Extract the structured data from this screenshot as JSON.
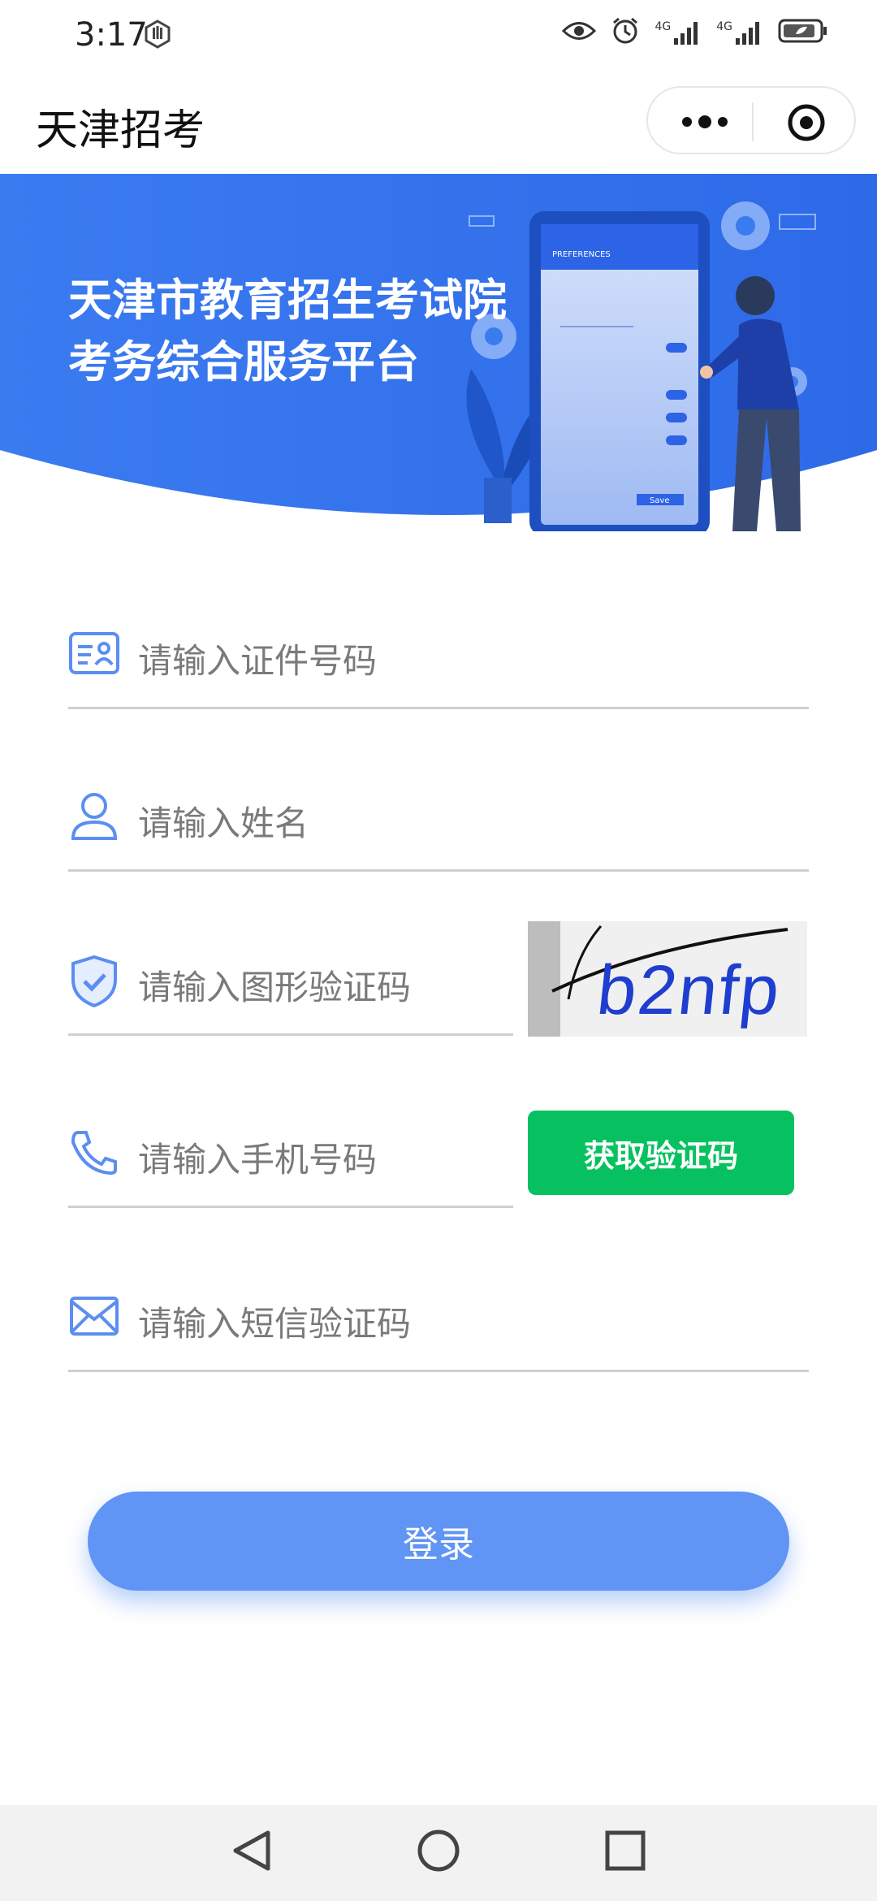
{
  "status_bar": {
    "time": "3:17",
    "icons": [
      "hand-icon",
      "eye-icon",
      "alarm-icon",
      "signal-4g-icon",
      "signal-4g-icon",
      "battery-icon"
    ],
    "network_1": "4G",
    "network_2": "4G"
  },
  "title_bar": {
    "title": "天津招考",
    "more_icon": "more-dots-icon",
    "close_icon": "target-close-icon"
  },
  "banner": {
    "line1": "天津市教育招生考试院",
    "line2": "考务综合服务平台",
    "phone_heading": "PREFERENCES",
    "phone_save": "Save"
  },
  "form": {
    "id_placeholder": "请输入证件号码",
    "name_placeholder": "请输入姓名",
    "captcha_placeholder": "请输入图形验证码",
    "captcha_text": "b2nfp",
    "phone_placeholder": "请输入手机号码",
    "get_code_label": "获取验证码",
    "sms_placeholder": "请输入短信验证码",
    "login_label": "登录"
  },
  "colors": {
    "banner": "#3f7ff2",
    "login": "#6094f5",
    "sms_button": "#07c160",
    "icon_blue": "#5b8ef0"
  },
  "nav_bar": {
    "icons": [
      "back-triangle-icon",
      "home-circle-icon",
      "recent-square-icon"
    ]
  }
}
